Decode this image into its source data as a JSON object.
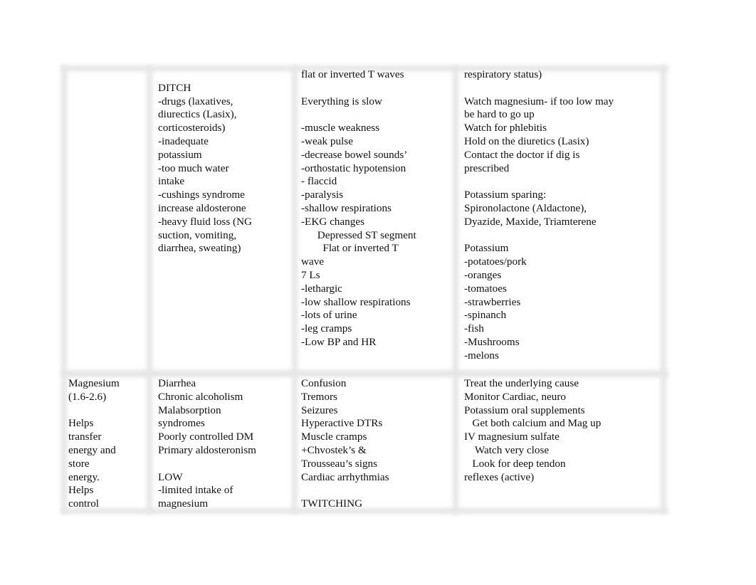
{
  "table": {
    "row1": {
      "col1": [],
      "col2": [
        "",
        "DITCH",
        "-drugs (laxatives,",
        "diurectics (Lasix),",
        "corticosteroids)",
        "-inadequate",
        "potassium",
        "-too much water",
        "intake",
        "-cushings syndrome",
        "increase aldosterone",
        "-heavy fluid loss (NG",
        "suction, vomiting,",
        "diarrhea, sweating)"
      ],
      "col3": [
        "flat or inverted T waves",
        "",
        "Everything is slow",
        "",
        "-muscle weakness",
        "-weak pulse",
        "-decrease bowel sounds’",
        "-orthostatic hypotension",
        "- flaccid",
        "-paralysis",
        "-shallow respirations",
        "-EKG changes",
        "      Depressed ST segment",
        "        Flat or inverted T",
        "wave",
        "7 Ls",
        "-lethargic",
        "-low shallow respirations",
        "-lots of urine",
        "-leg cramps",
        "-Low BP and HR"
      ],
      "col4": [
        "respiratory status)",
        "",
        "Watch magnesium- if too low may",
        "be hard to go up",
        "Watch for phlebitis",
        "Hold on the diuretics (Lasix)",
        "Contact the doctor if dig is",
        "prescribed",
        "",
        "Potassium sparing:",
        "Spironolactone (Aldactone),",
        "Dyazide, Maxide, Triamterene",
        "",
        "Potassium",
        "-potatoes/pork",
        "-oranges",
        "-tomatoes",
        "-strawberries",
        "-spinanch",
        "-fish",
        "-Mushrooms",
        "-melons"
      ]
    },
    "row2": {
      "col1": [
        "Magnesium",
        "(1.6-2.6)",
        "",
        "Helps",
        "transfer",
        "energy and",
        "store",
        "energy.",
        "Helps",
        "control"
      ],
      "col2": [
        "Diarrhea",
        "Chronic alcoholism",
        "Malabsorption",
        "syndromes",
        "Poorly controlled DM",
        "Primary aldosteronism",
        "",
        "LOW",
        "-limited intake of",
        "magnesium"
      ],
      "col3": [
        "Confusion",
        "Tremors",
        "Seizures",
        "Hyperactive DTRs",
        "Muscle cramps",
        "+Chvostek’s &",
        "Trousseau’s signs",
        "Cardiac arrhythmias",
        "",
        "TWITCHING"
      ],
      "col4": [
        "Treat the underlying cause",
        "Monitor Cardiac, neuro",
        "Potassium oral supplements",
        "   Get both calcium and Mag up",
        "IV magnesium sulfate",
        "    Watch very close",
        "   Look for deep tendon",
        "reflexes (active)"
      ]
    }
  }
}
